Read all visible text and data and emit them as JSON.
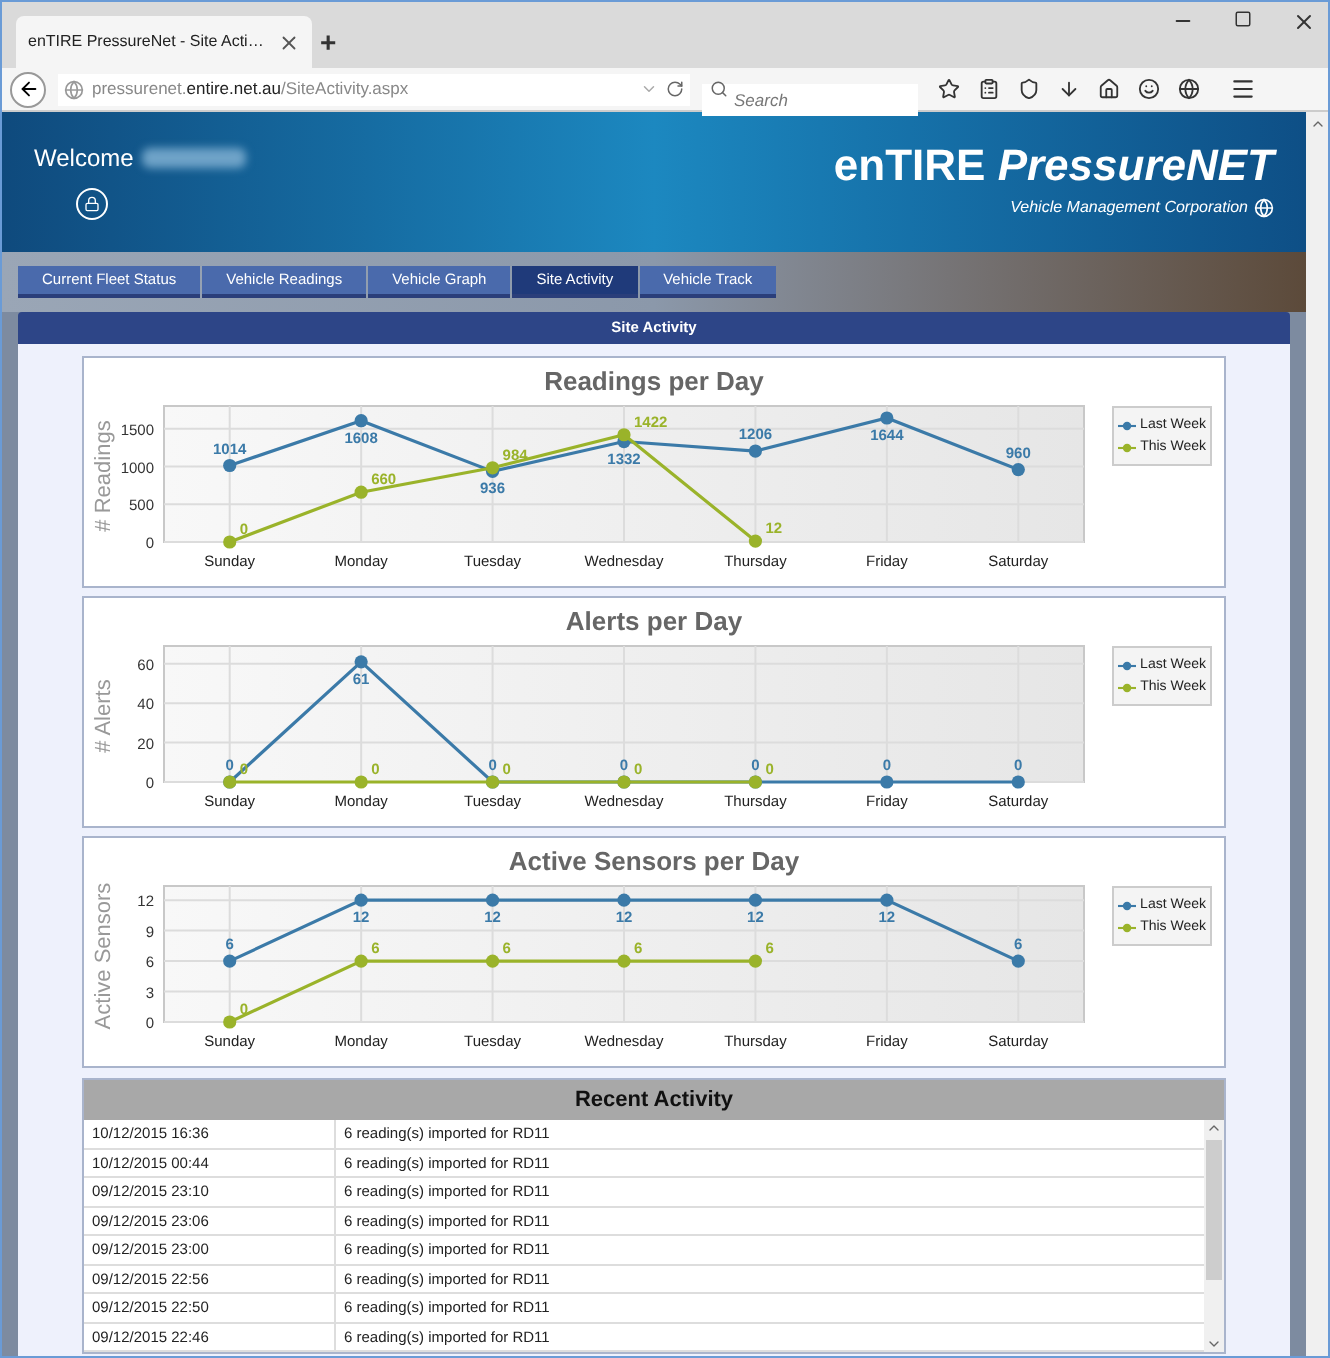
{
  "browser": {
    "tab_title": "enTIRE PressureNet - Site Acti…",
    "new_tab": "+",
    "url": "pressurenet.**entire.net.au**/SiteActivity.aspx",
    "search": {
      "placeholder": "Search"
    }
  },
  "header": {
    "welcome": "Welcome",
    "logo": "enTIRE *PressureNET*",
    "subtitle": "Vehicle Management Corporation"
  },
  "tabs": [
    {
      "label": "Current Fleet Status",
      "selected": false
    },
    {
      "label": "Vehicle Readings",
      "selected": false
    },
    {
      "label": "Vehicle Graph",
      "selected": false
    },
    {
      "label": "Site Activity",
      "selected": true
    },
    {
      "label": "Vehicle Track",
      "selected": false
    }
  ],
  "section_title": "Site Activity",
  "charts": [
    {
      "chart_data": {
        "type": "line",
        "title": "Readings per Day",
        "ylabel": "# Readings",
        "categories": [
          "Sunday",
          "Monday",
          "Tuesday",
          "Wednesday",
          "Thursday",
          "Friday",
          "Saturday"
        ],
        "ylim": [
          0,
          1750
        ],
        "yticks": [
          0,
          500,
          1000,
          1500
        ],
        "grid": true,
        "data_labels": true,
        "series": [
          {
            "name": "Last Week",
            "color": "#3b7aa8",
            "marker": "circle",
            "values": [
              1014,
              1608,
              936,
              1332,
              1206,
              1644,
              960
            ]
          },
          {
            "name": "This Week",
            "color": "#9ab32a",
            "marker": "circle",
            "values": [
              0,
              660,
              984,
              1422,
              12,
              null,
              null
            ]
          }
        ]
      }
    },
    {
      "chart_data": {
        "type": "line",
        "title": "Alerts per Day",
        "ylabel": "# Alerts",
        "categories": [
          "Sunday",
          "Monday",
          "Tuesday",
          "Wednesday",
          "Thursday",
          "Friday",
          "Saturday"
        ],
        "ylim": [
          0,
          67
        ],
        "yticks": [
          0,
          20,
          40,
          60
        ],
        "grid": true,
        "data_labels": true,
        "series": [
          {
            "name": "Last Week",
            "color": "#3b7aa8",
            "marker": "circle",
            "values": [
              0,
              61,
              0,
              0,
              0,
              0,
              0
            ]
          },
          {
            "name": "This Week",
            "color": "#9ab32a",
            "marker": "circle",
            "values": [
              0,
              0,
              0,
              0,
              0,
              null,
              null
            ]
          }
        ]
      }
    },
    {
      "chart_data": {
        "type": "line",
        "title": "Active Sensors per Day",
        "ylabel": "Active Sensors",
        "categories": [
          "Sunday",
          "Monday",
          "Tuesday",
          "Wednesday",
          "Thursday",
          "Friday",
          "Saturday"
        ],
        "ylim": [
          0,
          13
        ],
        "yticks": [
          0,
          3,
          6,
          9,
          12
        ],
        "grid": true,
        "data_labels": true,
        "series": [
          {
            "name": "Last Week",
            "color": "#3b7aa8",
            "marker": "circle",
            "values": [
              6,
              12,
              12,
              12,
              12,
              12,
              6
            ]
          },
          {
            "name": "This Week",
            "color": "#9ab32a",
            "marker": "circle",
            "values": [
              0,
              6,
              6,
              6,
              6,
              null,
              null
            ]
          }
        ]
      }
    }
  ],
  "recent_activity": {
    "title": "Recent Activity",
    "rows": [
      {
        "time": "10/12/2015 16:36",
        "event": "6 reading(s) imported for RD11"
      },
      {
        "time": "10/12/2015 00:44",
        "event": "6 reading(s) imported for RD11"
      },
      {
        "time": "09/12/2015 23:10",
        "event": "6 reading(s) imported for RD11"
      },
      {
        "time": "09/12/2015 23:06",
        "event": "6 reading(s) imported for RD11"
      },
      {
        "time": "09/12/2015 23:00",
        "event": "6 reading(s) imported for RD11"
      },
      {
        "time": "09/12/2015 22:56",
        "event": "6 reading(s) imported for RD11"
      },
      {
        "time": "09/12/2015 22:50",
        "event": "6 reading(s) imported for RD11"
      },
      {
        "time": "09/12/2015 22:46",
        "event": "6 reading(s) imported for RD11"
      }
    ]
  }
}
